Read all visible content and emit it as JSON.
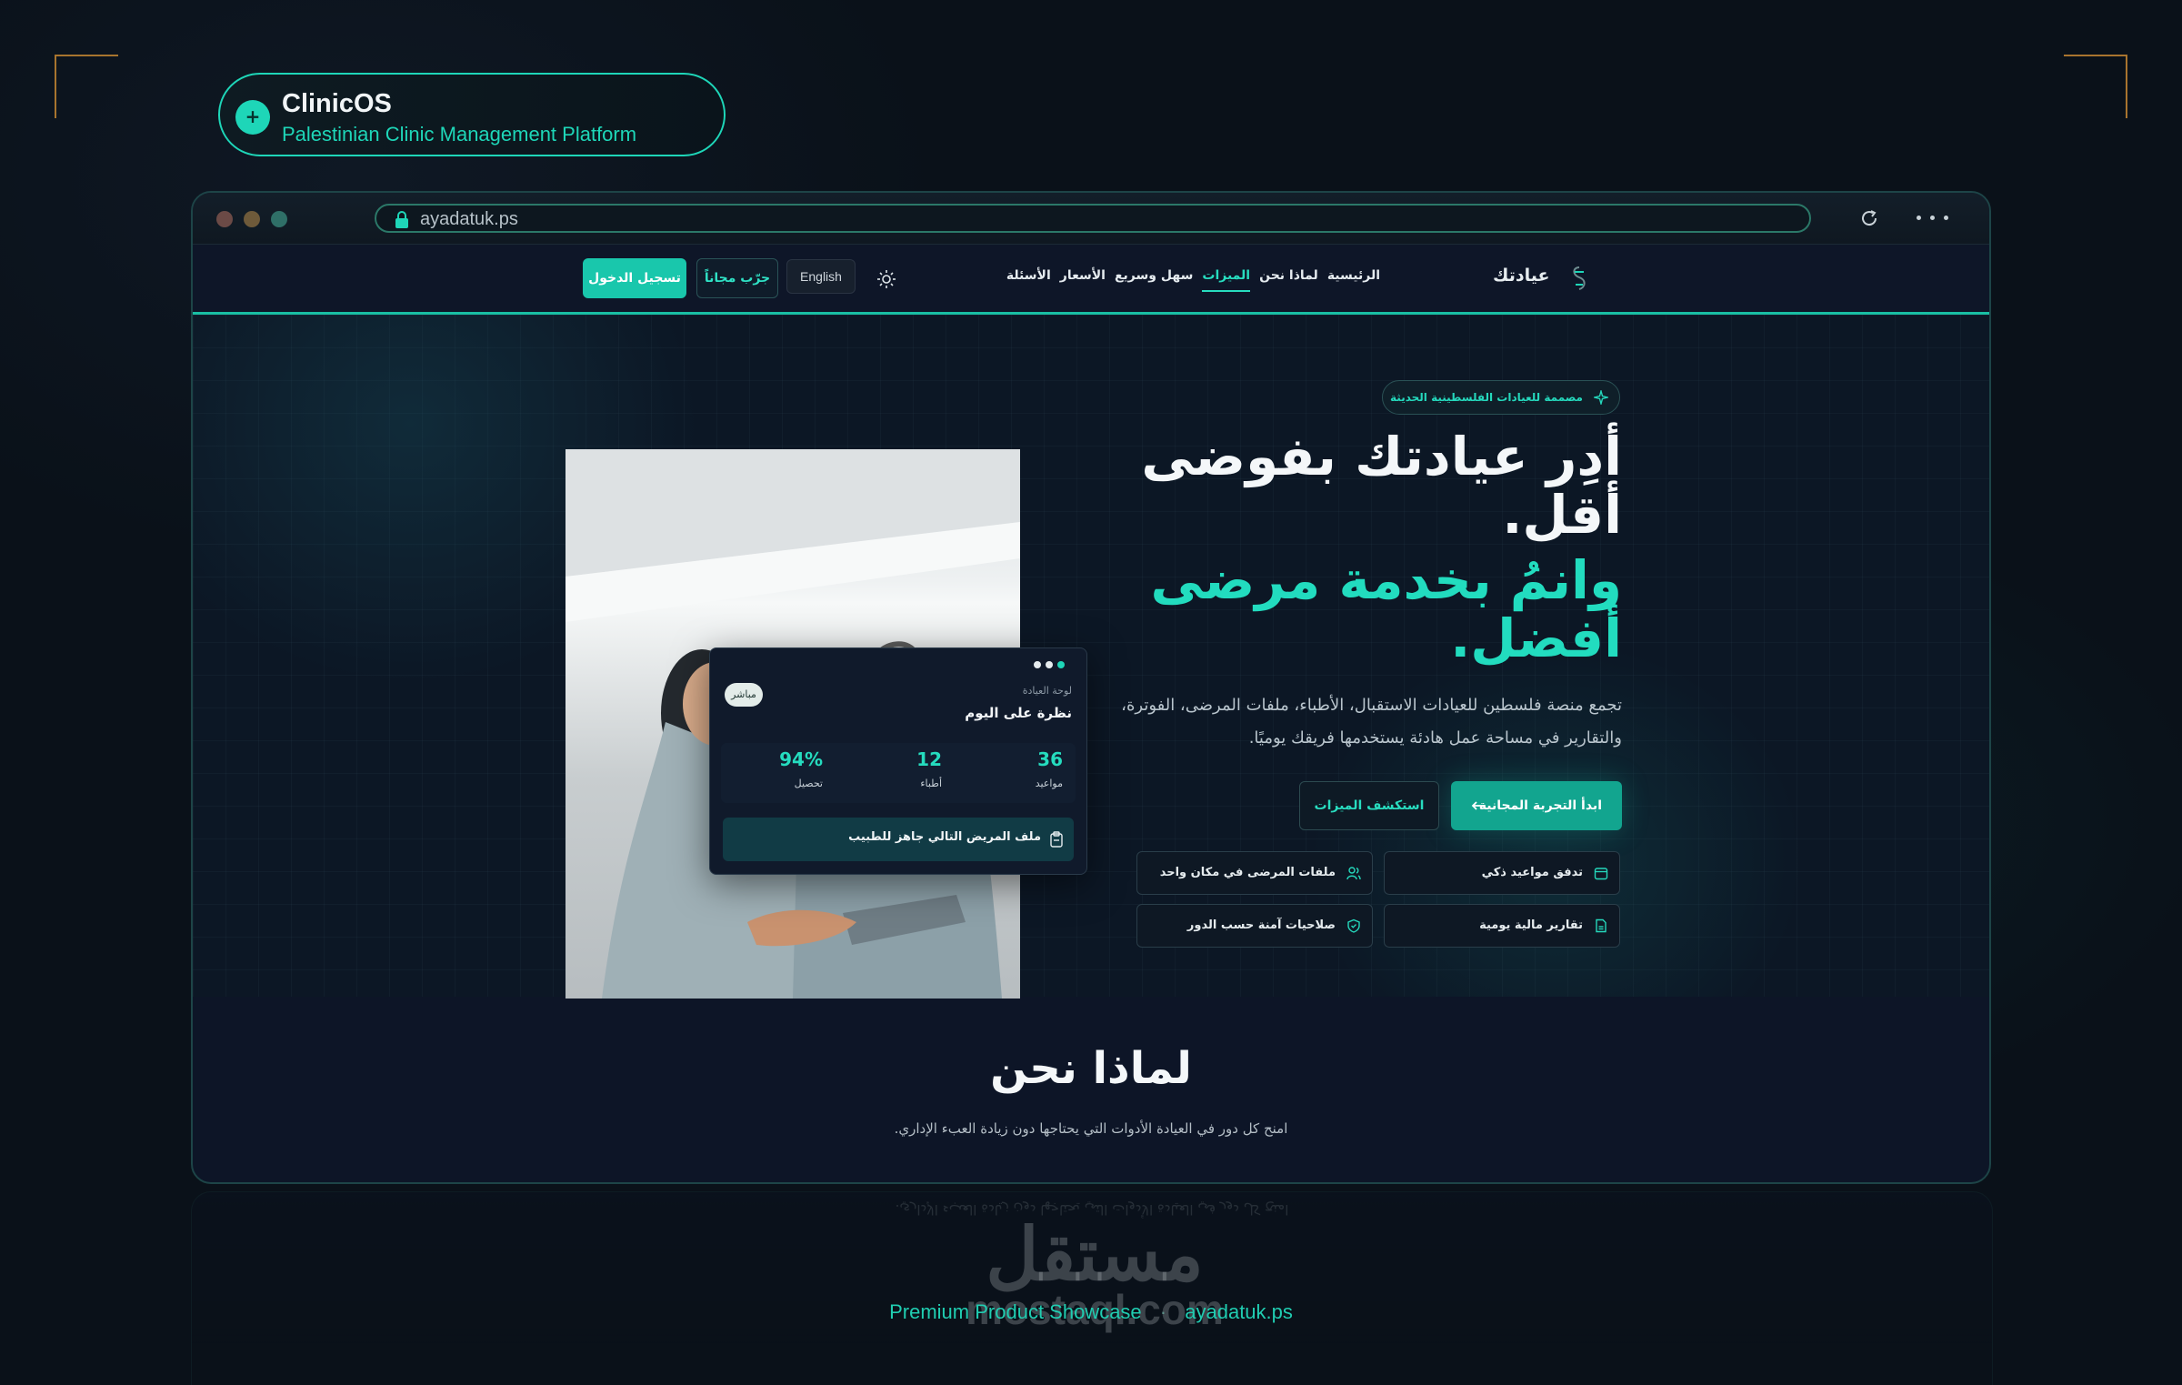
{
  "brand": {
    "name": "ClinicOS",
    "tagline": "Palestinian Clinic Management Platform"
  },
  "browser": {
    "url": "ayadatuk.ps"
  },
  "navbar": {
    "logo_text": "عيادتك",
    "links": [
      "الرئيسية",
      "لماذا نحن",
      "الميزات",
      "سهل وسريع",
      "الأسعار",
      "الأسئلة"
    ],
    "active_link": "الميزات",
    "language_button": "English",
    "try_button": "جرّب مجاناً",
    "login_button": "تسجيل الدخول"
  },
  "hero": {
    "badge": "مصممة للعيادات الفلسطينية الحديثة",
    "headline": "أدِر عيادتك بفوضى أقل.",
    "headline_accent": "وانمُ بخدمة مرضى أفضل.",
    "lead": "تجمع منصة فلسطين للعيادات الاستقبال، الأطباء، ملفات المرضى، الفوترة، والتقارير في مساحة عمل هادئة يستخدمها فريقك يوميًا.",
    "cta_primary": "ابدأ التجربة المجانية",
    "cta_secondary": "استكشف الميزات",
    "features": [
      "تدفق مواعيد ذكي",
      "ملفات المرضى في مكان واحد",
      "تقارير مالية يومية",
      "صلاحيات آمنة حسب الدور"
    ]
  },
  "dashboard_card": {
    "label": "لوحة العيادة",
    "title": "نظرة على اليوم",
    "live_badge": "مباشر",
    "stats": [
      {
        "value": "36",
        "label": "مواعيد"
      },
      {
        "value": "12",
        "label": "أطباء"
      },
      {
        "value": "94%",
        "label": "تحصيل"
      }
    ],
    "next_patient": "ملف المريض التالي جاهز للطبيب"
  },
  "why_section": {
    "title": "لماذا نحن",
    "subtitle": "امنح كل دور في العيادة الأدوات التي يحتاجها دون زيادة العبء الإداري."
  },
  "watermark": {
    "arabic": "مستقل",
    "latin": "mostaql.com"
  },
  "footer": {
    "label": "Premium Product Showcase",
    "separator": "·",
    "domain": "ayadatuk.ps"
  },
  "colors": {
    "accent": "#1ed6b8",
    "background": "#0a1119",
    "panel": "#0d1527",
    "corner_marks": "#a8742e"
  },
  "icons": [
    "plus-icon",
    "lock-icon",
    "reload-icon",
    "more-icon",
    "sun-icon",
    "logo-icon",
    "sparkle-icon",
    "arrow-left-icon",
    "calendar-icon",
    "users-icon",
    "file-icon",
    "shield-icon",
    "clipboard-icon"
  ]
}
